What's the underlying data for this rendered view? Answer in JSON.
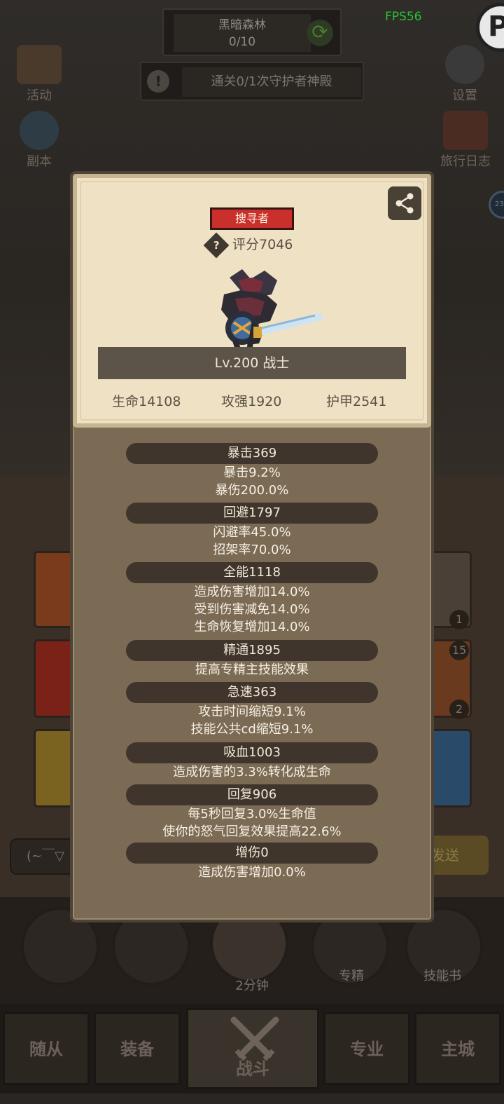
{
  "top": {
    "map_name": "黑暗森林",
    "map_progress": "0/10",
    "quest_text": "通关0/1次守护者神殿",
    "fps": "FPS56"
  },
  "side_left": [
    {
      "label": "活动",
      "icon": "calendar-icon"
    },
    {
      "label": "副本",
      "icon": "dungeon-portal-icon"
    }
  ],
  "side_right": [
    {
      "label": "设置",
      "icon": "gear-icon"
    },
    {
      "label": "旅行日志",
      "icon": "journal-icon"
    }
  ],
  "bg": {
    "slot_counts": [
      "1",
      "15",
      "2"
    ],
    "chat_text": "(~￣▽",
    "send_label": "发送",
    "timer_label": "2分钟",
    "specialty_label": "专精",
    "skillbook_label": "技能书"
  },
  "tabs": [
    "随从",
    "装备",
    "战斗",
    "专业",
    "主城"
  ],
  "modal": {
    "title_badge": "搜寻者",
    "rating": "评分7046",
    "level_class": "Lv.200 战士",
    "main_stats": [
      "生命14108",
      "攻强1920",
      "护甲2541"
    ],
    "sections": [
      {
        "header": "暴击369",
        "lines": [
          "暴击9.2%",
          "暴伤200.0%"
        ]
      },
      {
        "header": "回避1797",
        "lines": [
          "闪避率45.0%",
          "招架率70.0%"
        ]
      },
      {
        "header": "全能1118",
        "lines": [
          "造成伤害增加14.0%",
          "受到伤害减免14.0%",
          "生命恢复增加14.0%"
        ]
      },
      {
        "header": "精通1895",
        "lines": [
          "提高专精主技能效果"
        ]
      },
      {
        "header": "急速363",
        "lines": [
          "攻击时间缩短9.1%",
          "技能公共cd缩短9.1%"
        ]
      },
      {
        "header": "吸血1003",
        "lines": [
          "造成伤害的3.3%转化成生命"
        ]
      },
      {
        "header": "回复906",
        "lines": [
          "每5秒回复3.0%生命值",
          "使你的怒气回复效果提高22.6%"
        ]
      },
      {
        "header": "增伤0",
        "lines": [
          "造成伤害增加0.0%"
        ]
      }
    ]
  },
  "colors": {
    "badge_red": "#c9302c",
    "card_bg": "#efe1c4",
    "panel_bg": "#7b6a54",
    "pill_bg": "#3f352c",
    "fps_green": "#27c236"
  }
}
